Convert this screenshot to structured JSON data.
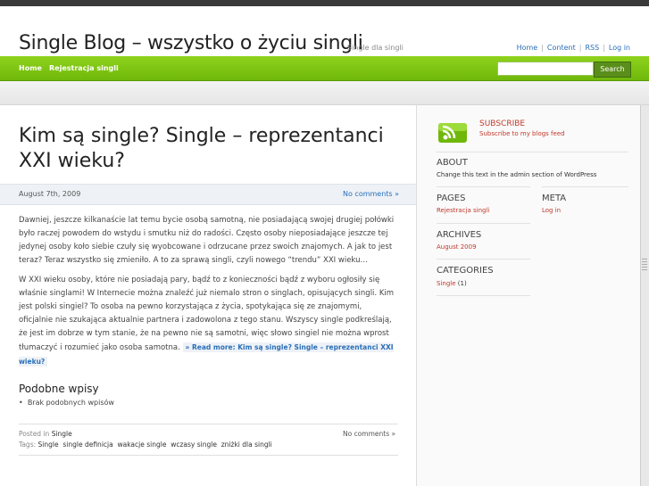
{
  "header": {
    "site_title": "Single Blog – wszystko o życiu singli",
    "site_description": "Single dla singli",
    "top_links": [
      "Home",
      "Content",
      "RSS",
      "Log in"
    ]
  },
  "nav": {
    "items": [
      "Home",
      "Rejestracja singli"
    ],
    "search_button": "Search",
    "search_value": ""
  },
  "post": {
    "title": "Kim są single? Single – reprezentanci XXI wieku?",
    "date": "August 7th, 2009",
    "comments_link": "No comments »",
    "paragraph1": "Dawniej, jeszcze kilkanaście lat temu bycie osobą samotną, nie posiadającą swojej drugiej połówki było raczej powodem do wstydu i smutku niż do radości.  Często osoby nieposiadające jeszcze tej jedynej osoby koło siebie czuły się wyobcowane i odrzucane przez swoich znajomych. A jak to jest teraz? Teraz wszystko się zmieniło. A to za sprawą singli, czyli nowego “trendu” XXI wieku…",
    "paragraph2": "W XXI wieku osoby, które nie posiadają pary, bądź to z konieczności bądź z wyboru ogłosiły się właśnie singlami! W Internecie można znaleźć już niemalo stron o singlach, opisujących singli. Kim jest polski singiel? To osoba na pewno korzystająca z życia, spotykająca się ze znajomymi, oficjalnie nie szukająca aktualnie partnera i zadowolona z tego stanu. Wszyscy single podkreślają, że jest im dobrze w tym stanie, że na pewno nie są samotni, więc słowo singiel nie można wprost tłumaczyć i rozumieć jako osoba samotna.",
    "read_more": "» Read more: Kim są single? Single – reprezentanci XXI wieku?",
    "similar_title": "Podobne wpisy",
    "similar_items": [
      "Brak podobnych wpisów"
    ],
    "posted_in_label": "Posted in",
    "posted_in_value": "Single",
    "tags_label": "Tags:",
    "tags": [
      "Single",
      "single definicja",
      "wakacje single",
      "wczasy single",
      "zniżki dla singli"
    ],
    "footer_comments": "No comments »"
  },
  "sidebar": {
    "subscribe_title": "SUBSCRIBE",
    "subscribe_text": "Subscribe to my blogs feed",
    "about_title": "ABOUT",
    "about_text": "Change this text in the admin section of WordPress",
    "pages_title": "PAGES",
    "pages_items": [
      "Rejestracja singli"
    ],
    "meta_title": "META",
    "meta_items": [
      "Log in"
    ],
    "archives_title": "ARCHIVES",
    "archives_items": [
      "August 2009"
    ],
    "categories_title": "CATEGORIES",
    "categories_item": "Single",
    "categories_count": "(1)"
  },
  "colors": {
    "nav_green": "#7bc310",
    "link_blue": "#2a6fb8",
    "sidebar_red": "#c0392b"
  }
}
